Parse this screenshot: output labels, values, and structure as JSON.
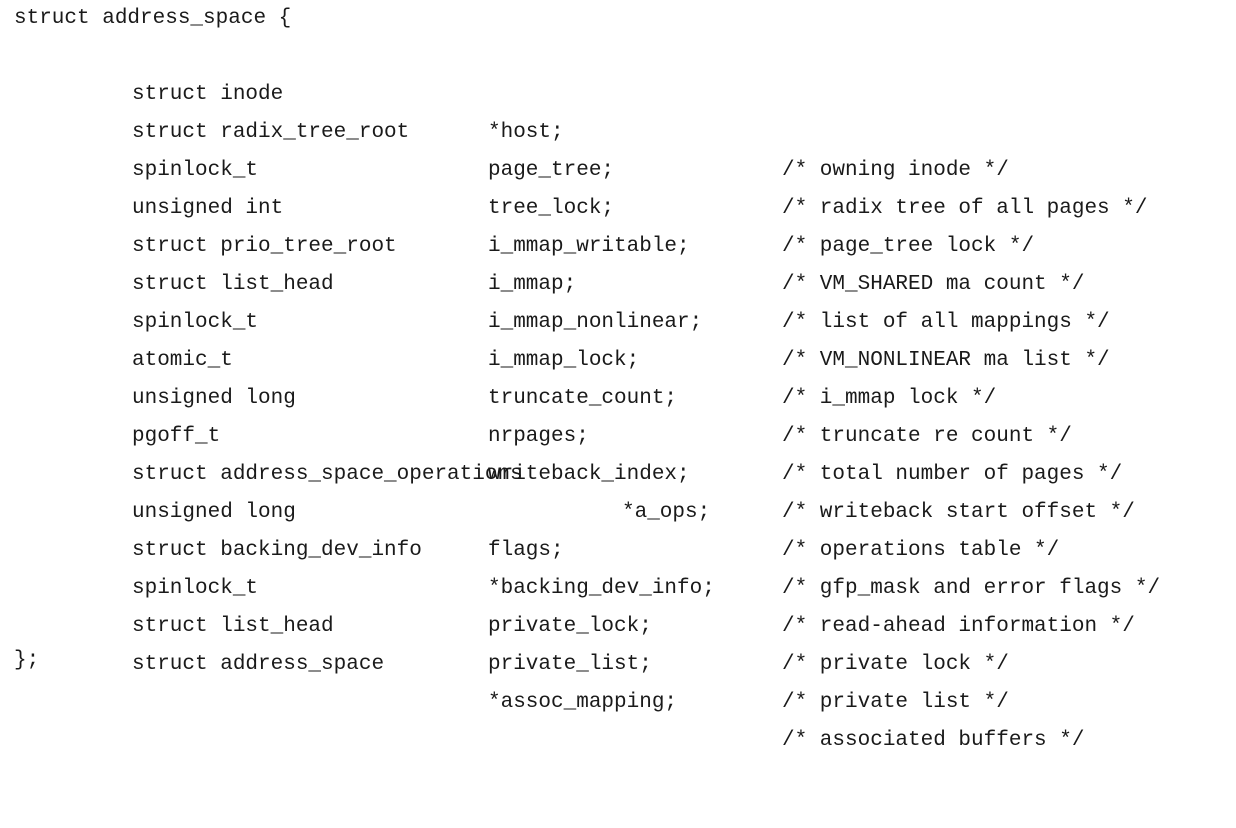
{
  "code": {
    "header": "struct address_space {",
    "footer": "};",
    "fields": [
      {
        "type": "struct inode",
        "name": "*host;",
        "comment": "/* owning inode */"
      },
      {
        "type": "struct radix_tree_root",
        "name": "page_tree;",
        "comment": "/* radix tree of all pages */"
      },
      {
        "type": "spinlock_t",
        "name": "tree_lock;",
        "comment": "/* page_tree lock */"
      },
      {
        "type": "unsigned int",
        "name": "i_mmap_writable;",
        "comment": "/* VM_SHARED ma count */"
      },
      {
        "type": "struct prio_tree_root",
        "name": "i_mmap;",
        "comment": "/* list of all mappings */"
      },
      {
        "type": "struct list_head",
        "name": "i_mmap_nonlinear;",
        "comment": "/* VM_NONLINEAR ma list */"
      },
      {
        "type": "spinlock_t",
        "name": "i_mmap_lock;",
        "comment": "/* i_mmap lock */"
      },
      {
        "type": "atomic_t",
        "name": "truncate_count;",
        "comment": "/* truncate re count */"
      },
      {
        "type": "unsigned long",
        "name": "nrpages;",
        "comment": "/* total number of pages */"
      },
      {
        "type": "pgoff_t",
        "name": "writeback_index;",
        "comment": "/* writeback start offset */"
      },
      {
        "type": "struct address_space_operations",
        "name": "*a_ops;",
        "comment": "/* operations table */"
      },
      {
        "type": "unsigned long",
        "name": "flags;",
        "comment": "/* gfp_mask and error flags */"
      },
      {
        "type": "struct backing_dev_info",
        "name": "*backing_dev_info;",
        "comment": "/* read-ahead information */"
      },
      {
        "type": "spinlock_t",
        "name": "private_lock;",
        "comment": "/* private lock */"
      },
      {
        "type": "struct list_head",
        "name": "private_list;",
        "comment": "/* private list */"
      },
      {
        "type": "struct address_space",
        "name": "*assoc_mapping;",
        "comment": "/* associated buffers */"
      }
    ]
  }
}
